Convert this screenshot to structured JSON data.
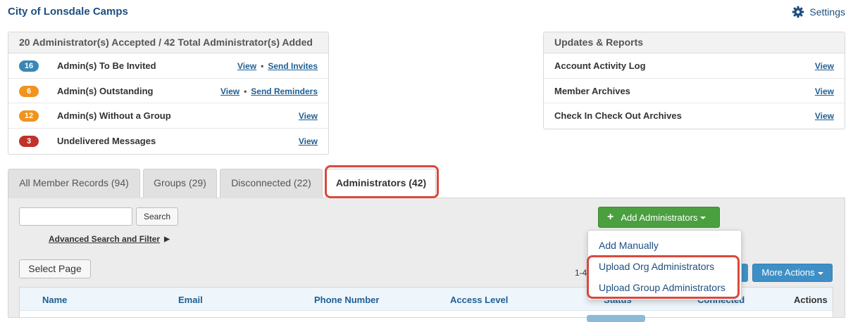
{
  "header": {
    "org_name": "City of Lonsdale Camps",
    "settings_label": "Settings"
  },
  "admin_summary": {
    "title": "20 Administrator(s) Accepted / 42 Total Administrator(s) Added",
    "rows": [
      {
        "count": "16",
        "label": "Admin(s) To Be Invited",
        "link1": "View",
        "link2": "Send Invites",
        "color": "#3a87b5"
      },
      {
        "count": "6",
        "label": "Admin(s) Outstanding",
        "link1": "View",
        "link2": "Send Reminders",
        "color": "#f0941d"
      },
      {
        "count": "12",
        "label": "Admin(s) Without a Group",
        "link1": "View",
        "color": "#f0941d"
      },
      {
        "count": "3",
        "label": "Undelivered Messages",
        "link1": "View",
        "color": "#c0322b"
      }
    ]
  },
  "updates": {
    "title": "Updates & Reports",
    "rows": [
      {
        "label": "Account Activity Log",
        "link": "View"
      },
      {
        "label": "Member Archives",
        "link": "View"
      },
      {
        "label": "Check In Check Out Archives",
        "link": "View"
      }
    ]
  },
  "tabs": [
    {
      "label": "All Member Records (94)"
    },
    {
      "label": "Groups (29)"
    },
    {
      "label": "Disconnected (22)"
    },
    {
      "label": "Administrators (42)",
      "active": true
    }
  ],
  "toolbar": {
    "search_value": "",
    "search_button": "Search",
    "advanced_search": "Advanced Search and Filter",
    "advanced_arrow": "▶",
    "select_page": "Select Page",
    "add_admins": "Add Administrators",
    "more_actions": "More Actions",
    "range_text": "1-4"
  },
  "dropdown": {
    "items": [
      "Add Manually",
      "Upload Org Administrators",
      "Upload Group Administrators"
    ]
  },
  "table": {
    "columns": [
      "Name",
      "Email",
      "Phone Number",
      "Access Level",
      "Status",
      "Connected",
      "Actions"
    ]
  },
  "colors": {
    "accent": "#1d4f80",
    "add_button": "#4a9f3f",
    "more_actions": "#3e8fc6",
    "highlight_outline": "#d9493c"
  }
}
